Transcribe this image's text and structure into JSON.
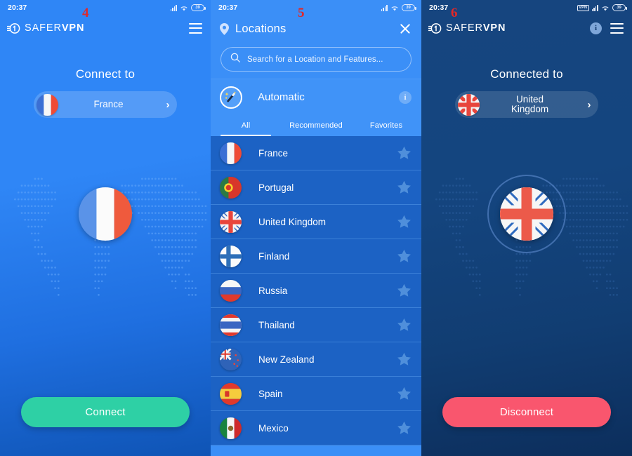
{
  "annotations": {
    "panel1": "4",
    "panel2": "5",
    "panel3": "6"
  },
  "statusbar": {
    "time": "20:37",
    "battery": "39",
    "vpn_badge": "VPN"
  },
  "panel_connect": {
    "logo": {
      "first": "SAFER",
      "second": "VPN"
    },
    "menu_icon": "hamburger-icon",
    "heading": "Connect to",
    "country": "France",
    "chevron": "›",
    "action_label": "Connect",
    "action_color": "#2ed0a5"
  },
  "panel_locations": {
    "title": "Locations",
    "pin_icon": "map-pin-icon",
    "close_icon": "close-icon",
    "search": {
      "placeholder": "Search for a Location and Features...",
      "icon": "search-icon"
    },
    "automatic": {
      "label": "Automatic",
      "icon": "magic-wand-icon",
      "info_icon": "info-icon",
      "info_char": "i"
    },
    "tabs": [
      {
        "label": "All",
        "active": true
      },
      {
        "label": "Recommended",
        "active": false
      },
      {
        "label": "Favorites",
        "active": false
      }
    ],
    "locations": [
      {
        "name": "France",
        "flag": "fr",
        "favorite": false
      },
      {
        "name": "Portugal",
        "flag": "pt",
        "favorite": false
      },
      {
        "name": "United Kingdom",
        "flag": "gb",
        "favorite": false
      },
      {
        "name": "Finland",
        "flag": "fi",
        "favorite": false
      },
      {
        "name": "Russia",
        "flag": "ru",
        "favorite": false
      },
      {
        "name": "Thailand",
        "flag": "th",
        "favorite": false
      },
      {
        "name": "New Zealand",
        "flag": "nz",
        "favorite": false
      },
      {
        "name": "Spain",
        "flag": "es",
        "favorite": false
      },
      {
        "name": "Mexico",
        "flag": "mx",
        "favorite": false
      }
    ]
  },
  "panel_connected": {
    "logo": {
      "first": "SAFER",
      "second": "VPN"
    },
    "info_char": "i",
    "menu_icon": "hamburger-icon",
    "heading": "Connected to",
    "country": "United\nKingdom",
    "chevron": "›",
    "action_label": "Disconnect",
    "action_color": "#f9566e"
  },
  "colors": {
    "connect_bg": "#2f86f6",
    "locations_bg": "#3b8ff7",
    "list_bg": "#1c62c4",
    "connected_bg": "#14457f",
    "accent_green": "#2ed0a5",
    "accent_red": "#f9566e",
    "annotation_red": "#e12828"
  }
}
